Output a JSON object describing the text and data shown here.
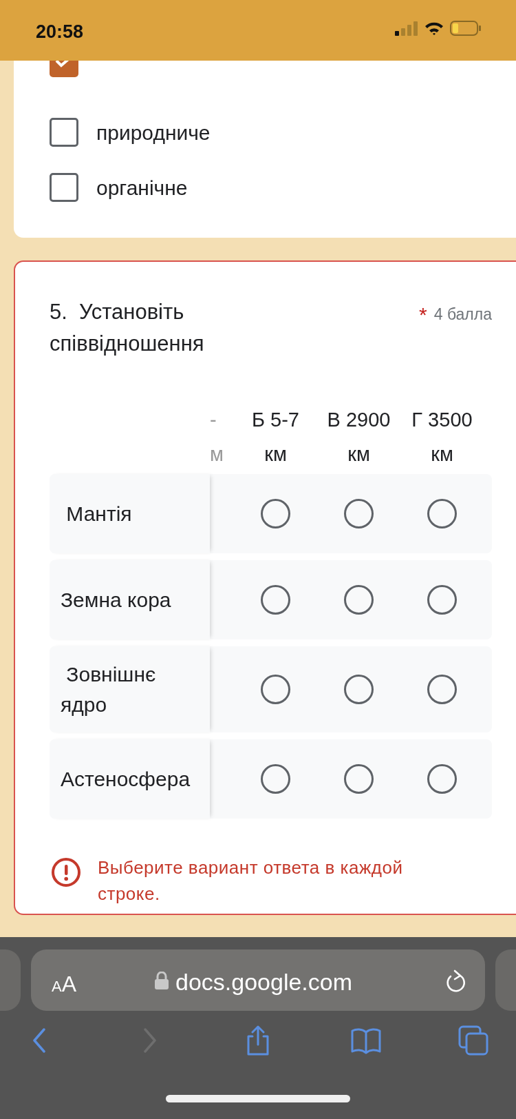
{
  "status_bar": {
    "time": "20:58"
  },
  "previous_question": {
    "options": [
      {
        "checked": true
      },
      {
        "label": "природниче",
        "checked": false
      },
      {
        "label": "органічне",
        "checked": false
      }
    ]
  },
  "question": {
    "number": "5.",
    "title": "Установіть співвідношення",
    "required_mark": "*",
    "points": "4 балла",
    "columns": [
      "-\nм",
      "Б 5-7\nкм",
      "В 2900\nкм",
      "Г 3500\nкм"
    ],
    "rows": [
      {
        "label": " Мантія",
        "options": [
          {
            "selected": false
          },
          {
            "selected": false
          },
          {
            "selected": false
          }
        ]
      },
      {
        "label": "Земна кора",
        "options": [
          {
            "selected": false
          },
          {
            "selected": false
          },
          {
            "selected": false
          }
        ]
      },
      {
        "label": " Зовнішнє\nядро",
        "options": [
          {
            "selected": false
          },
          {
            "selected": false
          },
          {
            "selected": false
          }
        ]
      },
      {
        "label": "Астеносфера",
        "options": [
          {
            "selected": false
          },
          {
            "selected": false
          },
          {
            "selected": false
          }
        ]
      }
    ],
    "error": "Выберите вариант ответа в каждой строке."
  },
  "browser": {
    "text_size_button": "AA",
    "url": "docs.google.com",
    "toolbar": [
      {
        "kind": "back",
        "disabled": false
      },
      {
        "kind": "forward",
        "disabled": true
      },
      {
        "kind": "share",
        "disabled": false
      },
      {
        "kind": "bookmarks",
        "disabled": false
      },
      {
        "kind": "tabs",
        "disabled": false
      }
    ]
  }
}
